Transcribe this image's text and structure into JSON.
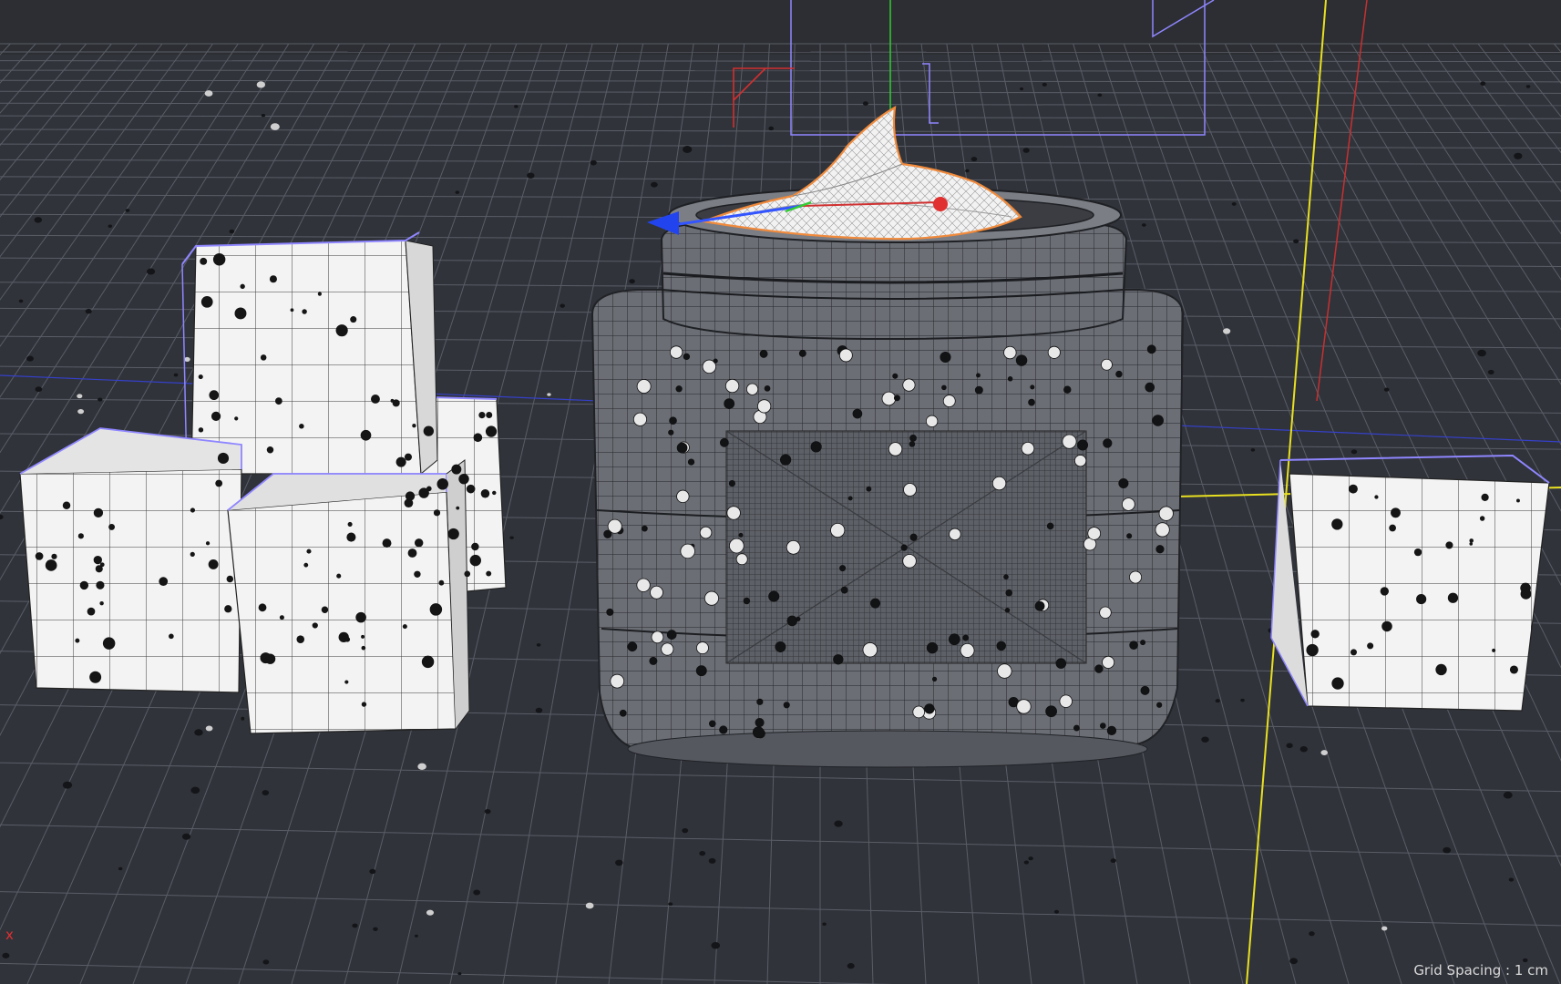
{
  "viewport": {
    "grid_spacing_label": "Grid Spacing : 1 cm",
    "axis_indicator_label": "x"
  },
  "scene": {
    "objects": [
      "cube-stack-left",
      "jar-body",
      "jar-lid-rim",
      "cream-swirl",
      "cube-right"
    ],
    "colors": {
      "background": "#2f3238",
      "grid": "#5d6068",
      "jar": "#6b6e75",
      "cube": "#f2f2f2",
      "selection": "#8f86ff",
      "highlight": "#f08a3c",
      "axis_x": "#e03030",
      "axis_y": "#33cc33",
      "axis_z": "#3355ff",
      "axis_guide": "#e8e020"
    }
  }
}
